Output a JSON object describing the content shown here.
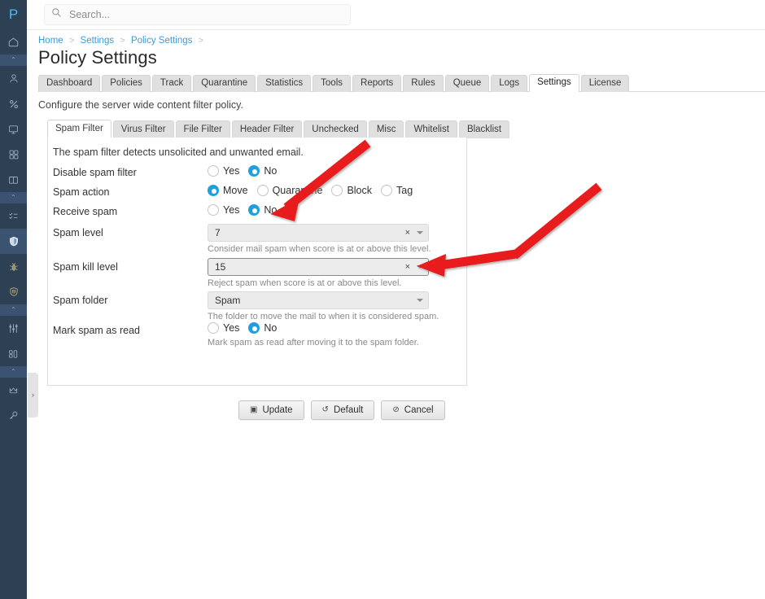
{
  "app": {
    "logo_letter": "P"
  },
  "search": {
    "value": "",
    "placeholder": "Search...",
    "icon": "search-icon"
  },
  "breadcrumb": {
    "items": [
      {
        "label": "Home"
      },
      {
        "label": "Settings"
      },
      {
        "label": "Policy Settings"
      }
    ],
    "separator": ">"
  },
  "page": {
    "title": "Policy Settings",
    "subtitle": "Configure the server wide content filter policy."
  },
  "main_tabs": [
    {
      "label": "Dashboard",
      "active": false
    },
    {
      "label": "Policies",
      "active": false
    },
    {
      "label": "Track",
      "active": false
    },
    {
      "label": "Quarantine",
      "active": false
    },
    {
      "label": "Statistics",
      "active": false
    },
    {
      "label": "Tools",
      "active": false
    },
    {
      "label": "Reports",
      "active": false
    },
    {
      "label": "Rules",
      "active": false
    },
    {
      "label": "Queue",
      "active": false
    },
    {
      "label": "Logs",
      "active": false
    },
    {
      "label": "Settings",
      "active": true
    },
    {
      "label": "License",
      "active": false
    }
  ],
  "sub_tabs": [
    {
      "label": "Spam Filter",
      "active": true
    },
    {
      "label": "Virus Filter",
      "active": false
    },
    {
      "label": "File Filter",
      "active": false
    },
    {
      "label": "Header Filter",
      "active": false
    },
    {
      "label": "Unchecked",
      "active": false
    },
    {
      "label": "Misc",
      "active": false
    },
    {
      "label": "Whitelist",
      "active": false
    },
    {
      "label": "Blacklist",
      "active": false
    }
  ],
  "form": {
    "intro": "The spam filter detects unsolicited and unwanted email.",
    "disable_spam_filter": {
      "label": "Disable spam filter",
      "options": [
        {
          "label": "Yes",
          "selected": false
        },
        {
          "label": "No",
          "selected": true
        }
      ]
    },
    "spam_action": {
      "label": "Spam action",
      "options": [
        {
          "label": "Move",
          "selected": true
        },
        {
          "label": "Quarantine",
          "selected": false
        },
        {
          "label": "Block",
          "selected": false
        },
        {
          "label": "Tag",
          "selected": false
        }
      ]
    },
    "receive_spam": {
      "label": "Receive spam",
      "options": [
        {
          "label": "Yes",
          "selected": false
        },
        {
          "label": "No",
          "selected": true
        }
      ]
    },
    "spam_level": {
      "label": "Spam level",
      "value": "7",
      "clear_glyph": "×",
      "hint": "Consider mail spam when score is at or above this level."
    },
    "spam_kill_level": {
      "label": "Spam kill level",
      "value": "15",
      "clear_glyph": "×",
      "hint": "Reject spam when score is at or above this level."
    },
    "spam_folder": {
      "label": "Spam folder",
      "value": "Spam",
      "hint": "The folder to move the mail to when it is considered spam."
    },
    "mark_spam_as_read": {
      "label": "Mark spam as read",
      "options": [
        {
          "label": "Yes",
          "selected": false
        },
        {
          "label": "No",
          "selected": true
        }
      ],
      "hint": "Mark spam as read after moving it to the spam folder."
    }
  },
  "buttons": [
    {
      "label": "Update",
      "icon": "save-icon",
      "glyph": "▣"
    },
    {
      "label": "Default",
      "icon": "undo-icon",
      "glyph": "↺"
    },
    {
      "label": "Cancel",
      "icon": "cancel-icon",
      "glyph": "⊘"
    }
  ],
  "sidebar": {
    "items": [
      {
        "name": "home-icon"
      },
      {
        "name": "user-icon"
      },
      {
        "name": "percent-icon"
      },
      {
        "name": "monitor-icon"
      },
      {
        "name": "grid-icon"
      },
      {
        "name": "book-icon"
      },
      {
        "name": "checklist-icon"
      },
      {
        "name": "shield-icon"
      },
      {
        "name": "bug-icon"
      },
      {
        "name": "globe-shield-icon"
      },
      {
        "name": "sliders-icon"
      },
      {
        "name": "modules-icon"
      },
      {
        "name": "crown-icon"
      },
      {
        "name": "key-icon"
      }
    ],
    "collapse_glyph": "⌃"
  },
  "panel_handle": {
    "glyph": "›"
  },
  "colors": {
    "sidebar_bg": "#2e4054",
    "accent_blue": "#1f9fe0",
    "link_blue": "#3d9ad4",
    "annotation_red": "#e81b1b",
    "logo_blue": "#4db8ef"
  },
  "annotations": [
    {
      "name": "arrow-to-receive-spam-no",
      "target": "Receive spam = No"
    },
    {
      "name": "arrow-to-spam-kill-level",
      "target": "Spam kill level dropdown"
    }
  ]
}
